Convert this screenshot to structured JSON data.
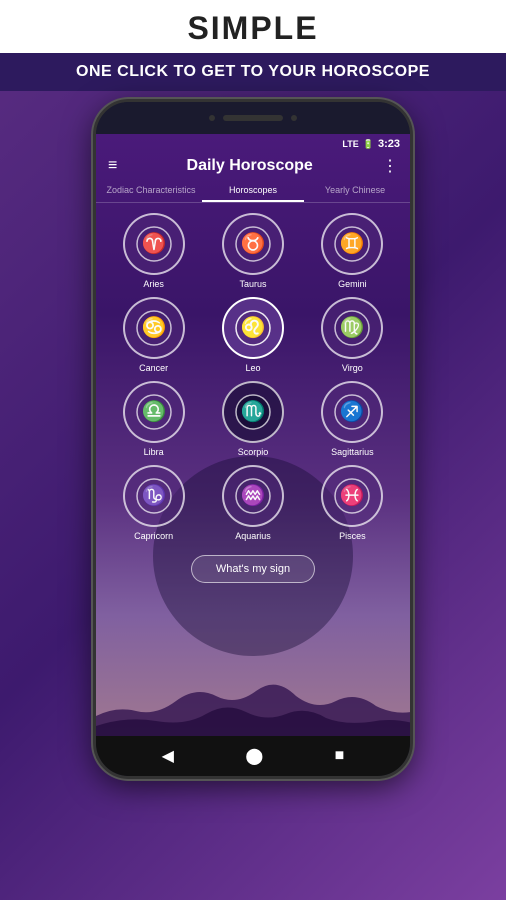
{
  "topBanner": {
    "simple": "SIMPLE",
    "subtitle": "ONE CLICK TO GET TO YOUR HOROSCOPE"
  },
  "statusBar": {
    "lte": "LTE",
    "battery": "🔋",
    "time": "3:23"
  },
  "appHeader": {
    "title": "Daily Horoscope",
    "hamburgerIcon": "≡",
    "moreIcon": "⋮"
  },
  "tabs": [
    {
      "label": "Zodiac Characteristics",
      "active": false
    },
    {
      "label": "Horoscopes",
      "active": true
    },
    {
      "label": "Yearly Chinese",
      "active": false
    }
  ],
  "zodiacSigns": [
    {
      "name": "Aries",
      "symbol": "♈"
    },
    {
      "name": "Taurus",
      "symbol": "♉"
    },
    {
      "name": "Gemini",
      "symbol": "♊"
    },
    {
      "name": "Cancer",
      "symbol": "♋"
    },
    {
      "name": "Leo",
      "symbol": "♌"
    },
    {
      "name": "Virgo",
      "symbol": "♍"
    },
    {
      "name": "Libra",
      "symbol": "♎"
    },
    {
      "name": "Scorpio",
      "symbol": "♏"
    },
    {
      "name": "Sagittarius",
      "symbol": "♐"
    },
    {
      "name": "Capricorn",
      "symbol": "♑"
    },
    {
      "name": "Aquarius",
      "symbol": "♒"
    },
    {
      "name": "Pisces",
      "symbol": "♓"
    }
  ],
  "whatsMySign": "What's my sign",
  "navButtons": {
    "back": "◀",
    "home": "⬤",
    "recent": "■"
  }
}
